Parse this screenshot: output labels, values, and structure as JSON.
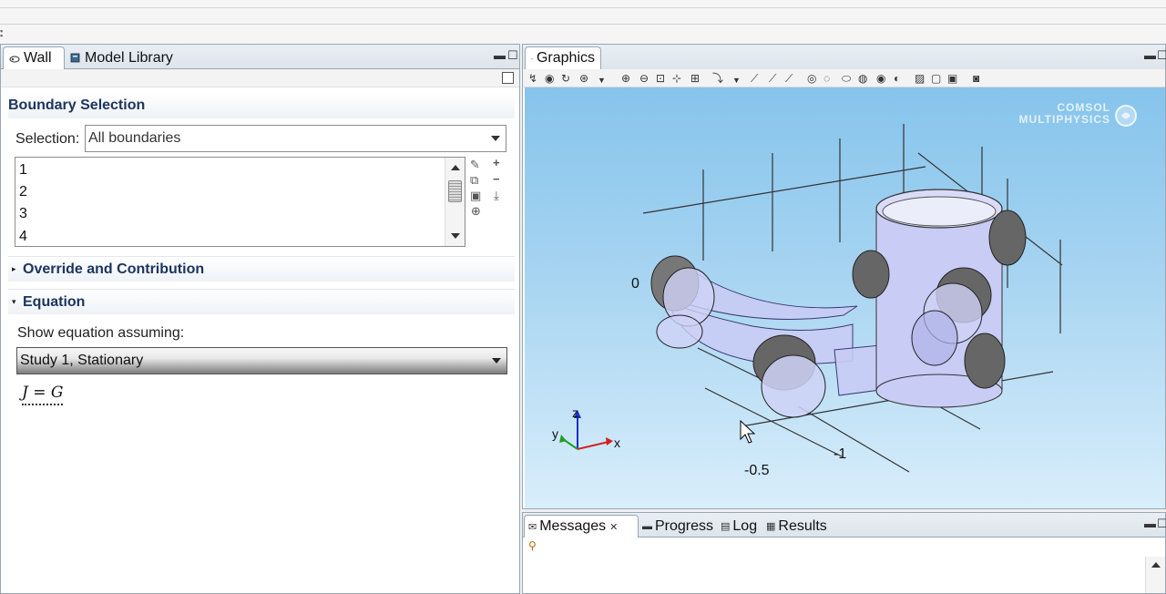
{
  "left_tabs": [
    {
      "label": "Wall",
      "icon": "wall-node-icon"
    },
    {
      "label": "Model Library",
      "icon": "book-icon"
    }
  ],
  "boundary_selection": {
    "title": "Boundary Selection",
    "selection_label": "Selection:",
    "selection_value": "All boundaries",
    "items": [
      "1",
      "2",
      "3",
      "4"
    ]
  },
  "override": {
    "title": "Override and Contribution"
  },
  "equation": {
    "title": "Equation",
    "show_label": "Show equation assuming:",
    "study_value": "Study 1, Stationary",
    "formula": "J = G"
  },
  "graphics": {
    "tab_label": "Graphics",
    "watermark_line1": "COMSOL",
    "watermark_line2": "MULTIPHYSICS",
    "axis_tick_0": "0",
    "axis_tick_neg1": "-1",
    "axis_tick_neg05": "-0.5",
    "triad_x": "x",
    "triad_y": "y",
    "triad_z": "z"
  },
  "messages_tabs": [
    {
      "label": "Messages",
      "icon": "envelope-icon"
    },
    {
      "label": "Progress",
      "icon": "progress-icon"
    },
    {
      "label": "Log",
      "icon": "log-icon"
    },
    {
      "label": "Results",
      "icon": "table-icon"
    }
  ],
  "colors": {
    "section_title": "#1c3560",
    "viewport_top": "#86c4ec",
    "geometry_fill": "#c8ccf5"
  }
}
